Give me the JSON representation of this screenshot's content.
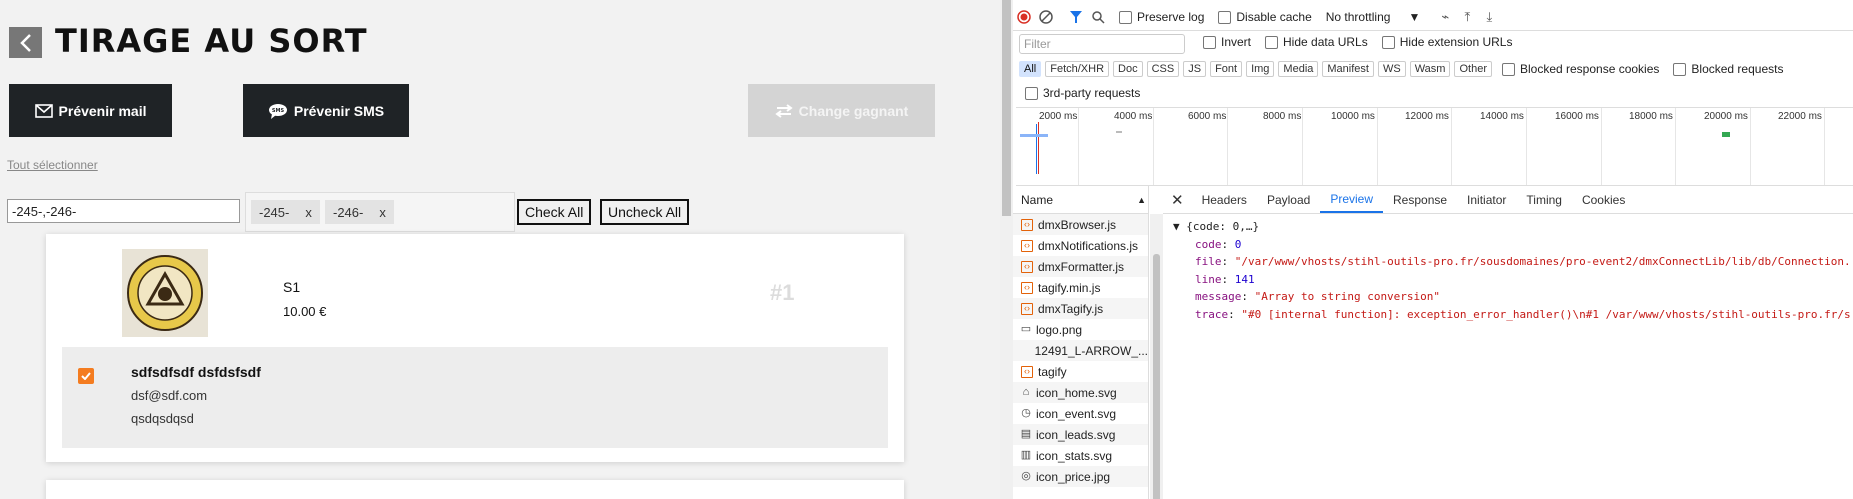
{
  "app": {
    "title": "TIRAGE AU SORT",
    "btn_mail": "Prévenir mail",
    "btn_sms": "Prévenir SMS",
    "btn_change": "Change gagnant",
    "select_all": "Tout sélectionner",
    "filter_value": "-245-,-246-",
    "tags": [
      "-245-",
      "-246-"
    ],
    "check_all": "Check All",
    "uncheck_all": "Uncheck All",
    "product": {
      "name": "S1",
      "price": "10.00 €",
      "rank": "#1"
    },
    "entry": {
      "name": "sdfsdfsdf dsfdsfsdf",
      "email": "dsf@sdf.com",
      "note": "qsdqsdqsd",
      "checked": true
    }
  },
  "devtools": {
    "toolbar": {
      "preserve_log": "Preserve log",
      "disable_cache": "Disable cache",
      "throttling": "No throttling"
    },
    "filter_placeholder": "Filter",
    "invert": "Invert",
    "hide_data_urls": "Hide data URLs",
    "hide_ext_urls": "Hide extension URLs",
    "types": [
      "All",
      "Fetch/XHR",
      "Doc",
      "CSS",
      "JS",
      "Font",
      "Img",
      "Media",
      "Manifest",
      "WS",
      "Wasm",
      "Other"
    ],
    "blocked_cookies": "Blocked response cookies",
    "blocked_requests": "Blocked requests",
    "third_party": "3rd-party requests",
    "timeline_ticks": [
      "2000 ms",
      "4000 ms",
      "6000 ms",
      "8000 ms",
      "10000 ms",
      "12000 ms",
      "14000 ms",
      "16000 ms",
      "18000 ms",
      "20000 ms",
      "22000 ms"
    ],
    "name_header": "Name",
    "files": [
      {
        "name": "dmxBrowser.js",
        "icon": "js-icon"
      },
      {
        "name": "dmxNotifications.js",
        "icon": "js-icon"
      },
      {
        "name": "dmxFormatter.js",
        "icon": "js-icon"
      },
      {
        "name": "tagify.min.js",
        "icon": "js-icon"
      },
      {
        "name": "dmxTagify.js",
        "icon": "js-icon"
      },
      {
        "name": "logo.png",
        "icon": "image-icon"
      },
      {
        "name": "12491_L-ARROW_...",
        "icon": "image-icon"
      },
      {
        "name": "tagify",
        "icon": "js-icon"
      },
      {
        "name": "icon_home.svg",
        "icon": "home-icon"
      },
      {
        "name": "icon_event.svg",
        "icon": "event-icon"
      },
      {
        "name": "icon_leads.svg",
        "icon": "leads-icon"
      },
      {
        "name": "icon_stats.svg",
        "icon": "stats-icon"
      },
      {
        "name": "icon_price.jpg",
        "icon": "price-icon"
      }
    ],
    "detail_tabs": [
      "Headers",
      "Payload",
      "Preview",
      "Response",
      "Initiator",
      "Timing",
      "Cookies"
    ],
    "active_tab": "Preview",
    "preview": {
      "root": "{code: 0,…}",
      "code_key": "code",
      "code_val": "0",
      "file_key": "file",
      "file_val": "\"/var/www/vhosts/stihl-outils-pro.fr/sousdomaines/pro-event2/dmxConnectLib/lib/db/Connection.",
      "line_key": "line",
      "line_val": "141",
      "message_key": "message",
      "message_val": "\"Array to string conversion\"",
      "trace_key": "trace",
      "trace_val": "\"#0 [internal function]: exception_error_handler()\\n#1 /var/www/vhosts/stihl-outils-pro.fr/s"
    }
  }
}
